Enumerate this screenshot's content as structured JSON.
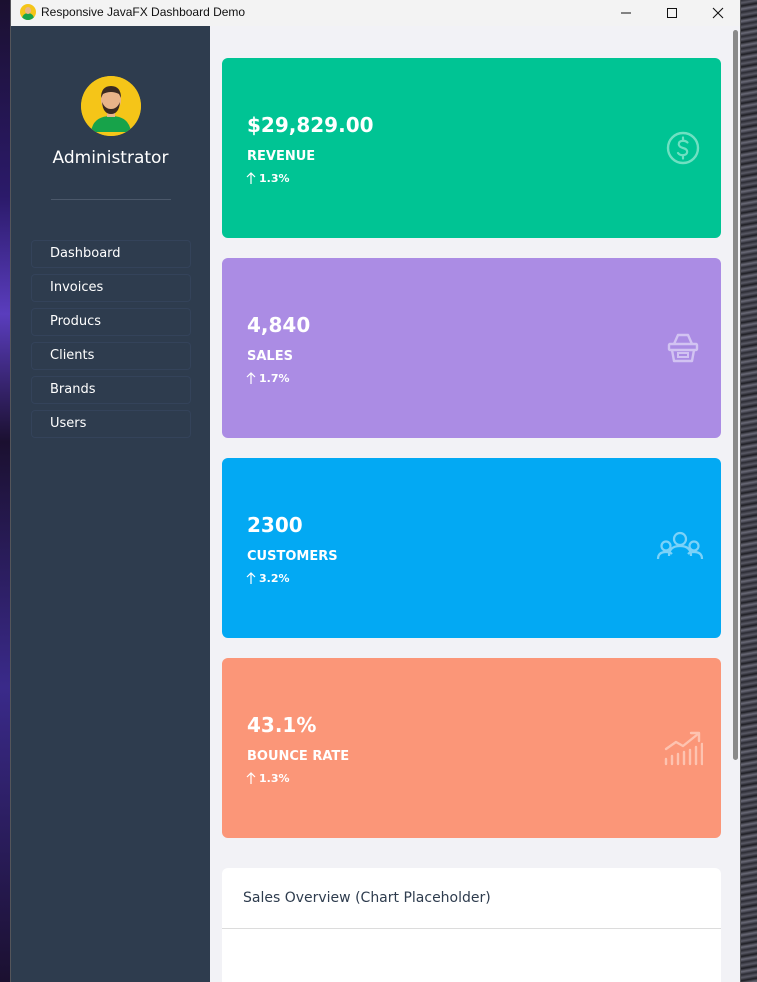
{
  "window": {
    "title": "Responsive JavaFX Dashboard Demo",
    "app_icon": "avatar-icon"
  },
  "sidebar": {
    "user_name": "Administrator",
    "avatar_icon": "user-avatar-icon",
    "items": [
      {
        "label": "Dashboard"
      },
      {
        "label": "Invoices"
      },
      {
        "label": "Producs"
      },
      {
        "label": "Clients"
      },
      {
        "label": "Brands"
      },
      {
        "label": "Users"
      }
    ]
  },
  "cards": [
    {
      "value": "$29,829.00",
      "label": "REVENUE",
      "change": "1.3%",
      "icon": "dollar-icon",
      "color": "#00c494"
    },
    {
      "value": "4,840",
      "label": "SALES",
      "change": "1.7%",
      "icon": "basket-icon",
      "color": "#ab8ce4"
    },
    {
      "value": "2300",
      "label": "CUSTOMERS",
      "change": "3.2%",
      "icon": "users-icon",
      "color": "#03a9f3"
    },
    {
      "value": "43.1%",
      "label": "BOUNCE RATE",
      "change": "1.3%",
      "icon": "trending-up-icon",
      "color": "#fb9678"
    }
  ],
  "chart_panel": {
    "title": "Sales Overview (Chart Placeholder)"
  },
  "colors": {
    "sidebar_bg": "#2e3c4e",
    "content_bg": "#f2f2f6"
  }
}
